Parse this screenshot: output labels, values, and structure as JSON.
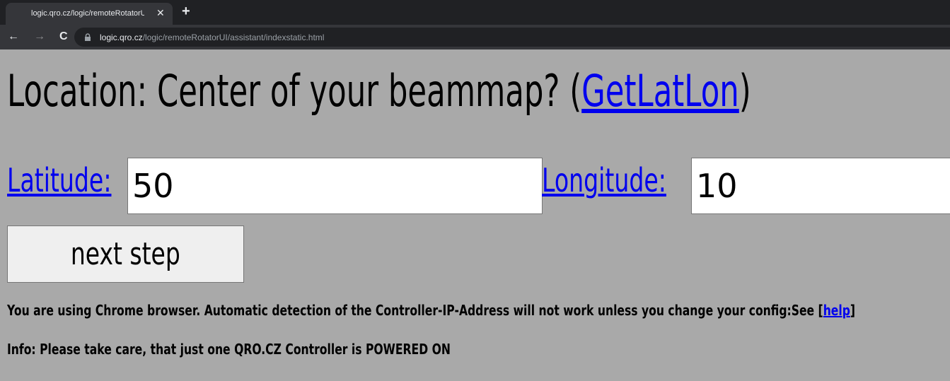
{
  "browser": {
    "tab_title": "logic.qro.cz/logic/remoteRotatorU",
    "tab_close": "✕",
    "new_tab": "+",
    "nav_back": "←",
    "nav_forward": "→",
    "nav_reload": "C",
    "url_host": "logic.qro.cz",
    "url_path": "/logic/remoteRotatorUI/assistant/indexstatic.html"
  },
  "page": {
    "heading_prefix": "Location: Center of your beammap? (",
    "heading_link": "GetLatLon",
    "heading_suffix": ")",
    "latitude_label": "Latitude: ",
    "latitude_value": "50",
    "longitude_label": " Longitude: ",
    "longitude_value": "10",
    "next_button": "next step",
    "info_chrome_text": "You are using Chrome browser. Automatic detection of the Controller-IP-Address will not work unless you change your config:See [",
    "info_help_link": "help",
    "info_chrome_close": "]",
    "info_power": "Info: Please take care, that just one QRO.CZ Controller is POWERED ON"
  },
  "colors": {
    "page_background": "#a9a9a9",
    "link": "#0000ee",
    "tabstrip": "#202124",
    "toolbar": "#35363a"
  }
}
